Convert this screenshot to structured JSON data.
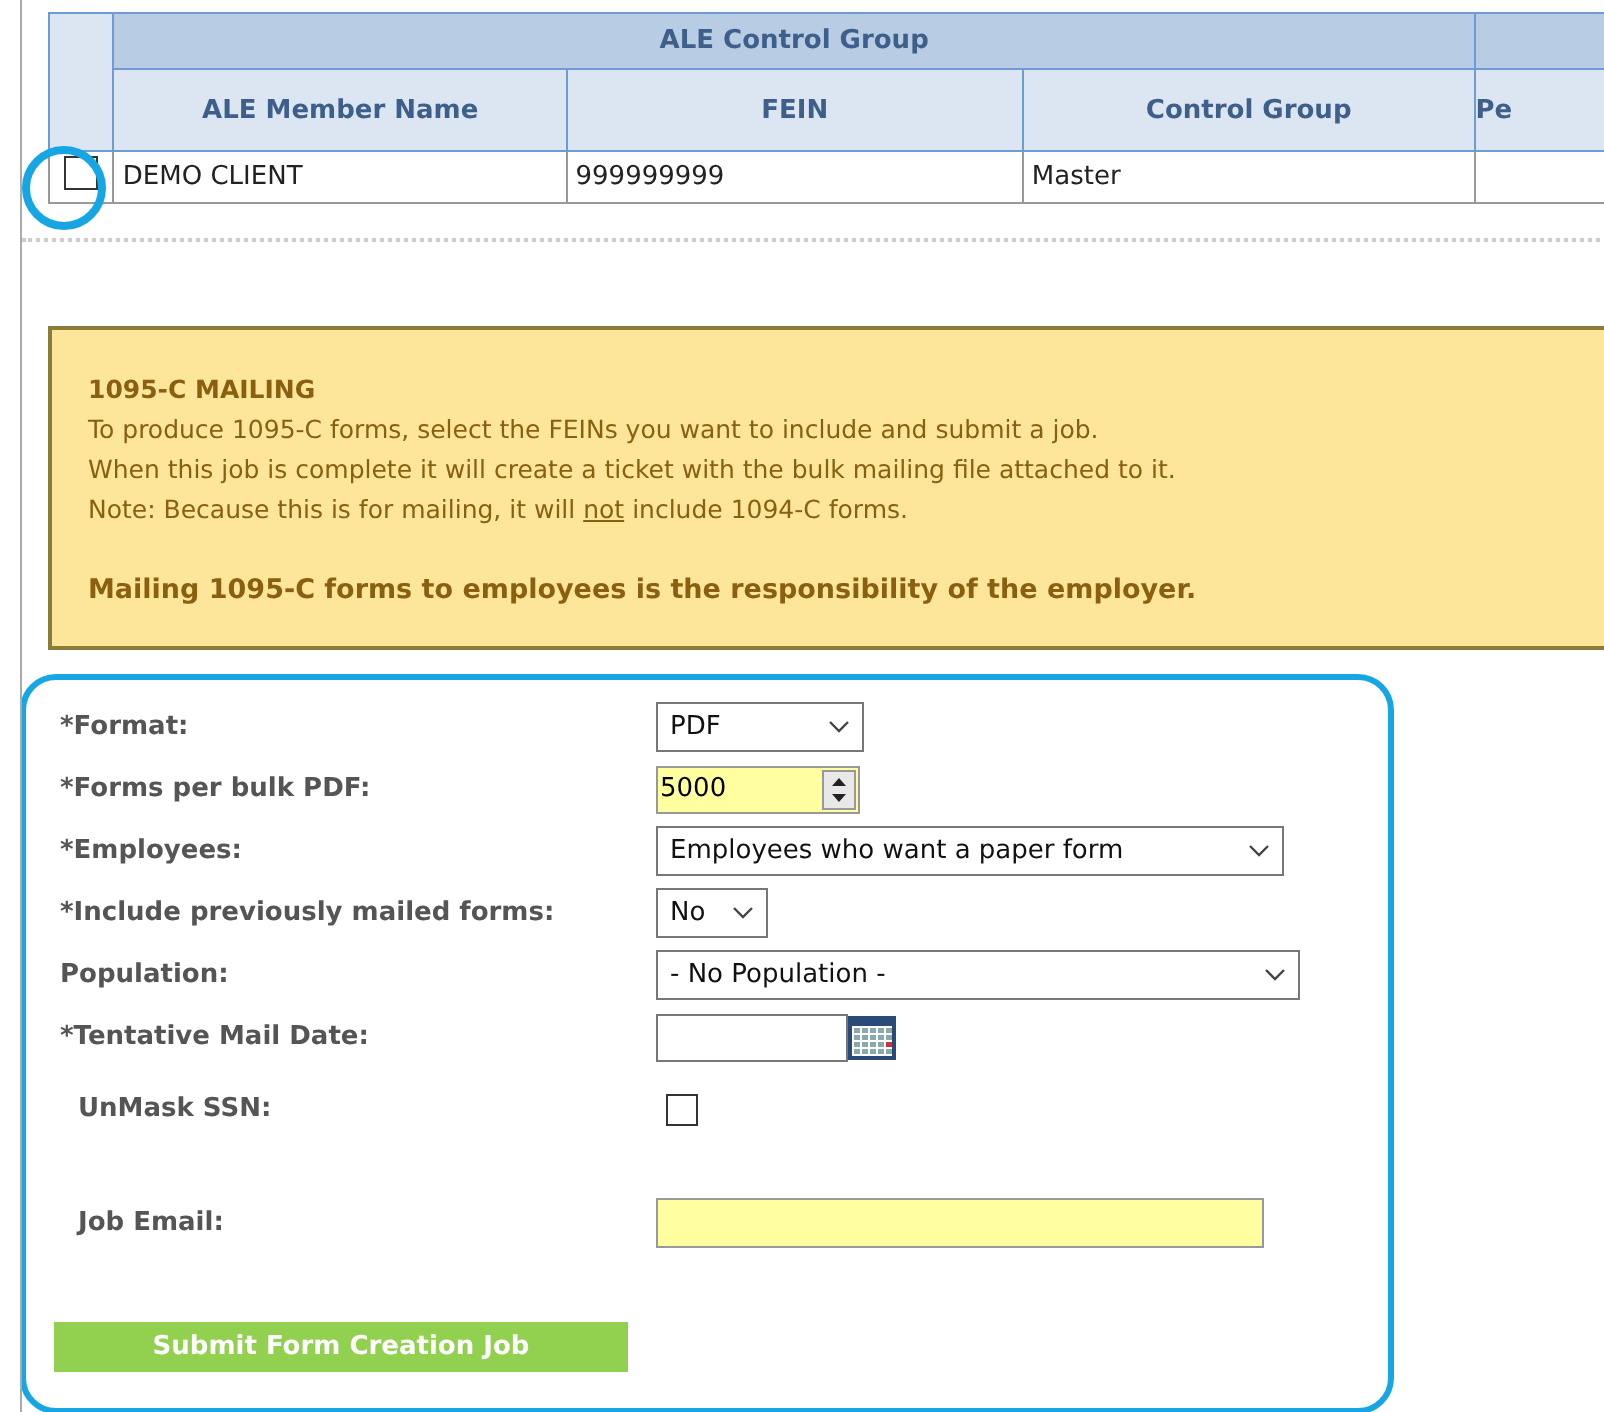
{
  "table": {
    "group_header": "ALE Control Group",
    "columns": [
      "ALE Member Name",
      "FEIN",
      "Control Group",
      "Pe"
    ],
    "rows": [
      {
        "checked": false,
        "cells": [
          "DEMO CLIENT",
          "999999999",
          "Master",
          ""
        ]
      }
    ]
  },
  "notice": {
    "title": "1095-C MAILING",
    "lines": [
      [
        {
          "text": "To produce 1095-C forms, select the FEINs you want to include and submit a job.",
          "underline": false
        }
      ],
      [
        {
          "text": "When this job is complete it will create a ticket with the bulk mailing file attached to it.",
          "underline": false
        }
      ],
      [
        {
          "text": "Note: Because this is for mailing, it will ",
          "underline": false
        },
        {
          "text": "not",
          "underline": true
        },
        {
          "text": " include 1094-C forms.",
          "underline": false
        }
      ]
    ],
    "warning": "Mailing 1095-C forms to employees is the responsibility of the employer."
  },
  "form": {
    "fields": [
      {
        "kind": "select",
        "label": "*Format:",
        "value": "PDF"
      },
      {
        "kind": "number",
        "label": "*Forms per bulk PDF:",
        "value": "5000"
      },
      {
        "kind": "select",
        "label": "*Employees:",
        "value": "Employees who want a paper form"
      },
      {
        "kind": "select",
        "label": "*Include previously mailed forms:",
        "value": "No"
      },
      {
        "kind": "select",
        "label": "Population:",
        "value": "- No Population -"
      },
      {
        "kind": "date",
        "label": "*Tentative Mail Date:"
      },
      {
        "kind": "checkbox",
        "label": "UnMask SSN:",
        "checked": false
      },
      {
        "kind": "text",
        "label": "Job Email:"
      }
    ],
    "submit": "Submit Form Creation Job"
  }
}
